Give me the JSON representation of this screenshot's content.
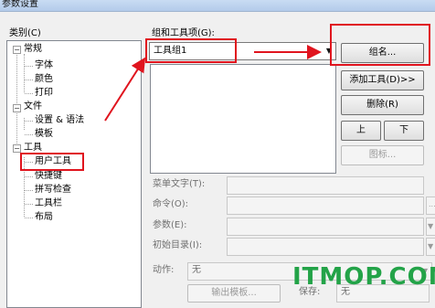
{
  "window": {
    "title": "参数设置"
  },
  "category": {
    "label": "类别(C)",
    "tree": [
      {
        "label": "常规",
        "expander": "−",
        "children": [
          "字体",
          "颜色",
          "打印"
        ]
      },
      {
        "label": "文件",
        "expander": "−",
        "children": [
          "设置 & 语法",
          "模板"
        ]
      },
      {
        "label": "工具",
        "expander": "−",
        "children": [
          "用户工具",
          "快捷键",
          "拼写检查",
          "工具栏",
          "布局"
        ]
      }
    ]
  },
  "tools": {
    "group_label": "组和工具项(G):",
    "group_value": "工具组1",
    "dropdown_arrow": "▼",
    "group_name_button": "组名...",
    "add_tool_button": "添加工具(D)>>",
    "delete_button": "删除(R)",
    "up_button": "上",
    "down_button": "下",
    "icon_button": "图标..."
  },
  "fields": {
    "menu_text_label": "菜单文字(T):",
    "command_label": "命令(O):",
    "command_browse": "...",
    "args_label": "参数(E):",
    "initdir_label": "初始目录(I):",
    "action_label": "动作:",
    "action_value": "无",
    "output_template_button": "输出模板...",
    "save_label": "保存:",
    "save_value": "无"
  },
  "watermark": "ITMOP.COM",
  "colors": {
    "annotation_red": "#e0141e",
    "watermark_green": "#23a348"
  }
}
